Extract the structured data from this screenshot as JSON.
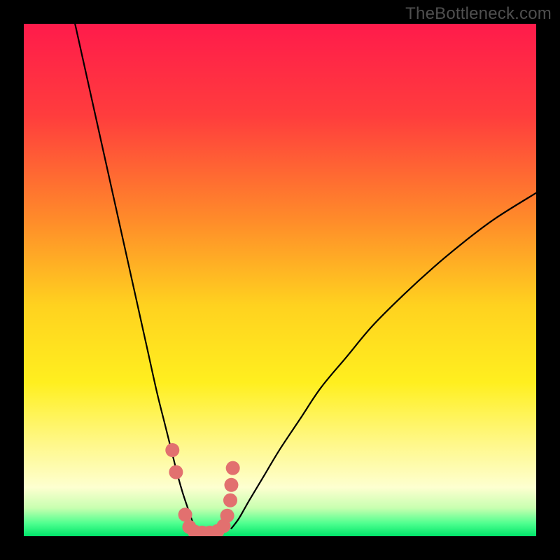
{
  "watermark": "TheBottleneck.com",
  "chart_data": {
    "type": "line",
    "title": "",
    "xlabel": "",
    "ylabel": "",
    "xlim": [
      0,
      100
    ],
    "ylim": [
      0,
      100
    ],
    "background_gradient": {
      "stops": [
        {
          "offset": 0.0,
          "color": "#ff1b4b"
        },
        {
          "offset": 0.18,
          "color": "#ff3d3d"
        },
        {
          "offset": 0.38,
          "color": "#ff8a2a"
        },
        {
          "offset": 0.55,
          "color": "#ffd21f"
        },
        {
          "offset": 0.7,
          "color": "#ffef1f"
        },
        {
          "offset": 0.82,
          "color": "#fff88a"
        },
        {
          "offset": 0.905,
          "color": "#fdffd0"
        },
        {
          "offset": 0.945,
          "color": "#c8ffb0"
        },
        {
          "offset": 0.975,
          "color": "#4fff8f"
        },
        {
          "offset": 1.0,
          "color": "#00e56a"
        }
      ]
    },
    "series": [
      {
        "name": "left-curve",
        "x": [
          10,
          12,
          14,
          16,
          18,
          20,
          22,
          24,
          26,
          27.5,
          29,
          30,
          31,
          32,
          32.8,
          33.5
        ],
        "y": [
          100,
          91,
          82,
          73,
          64,
          55,
          46,
          37,
          28,
          22,
          16,
          12,
          8.5,
          5.5,
          3.2,
          1.5
        ],
        "stroke": "#000000",
        "stroke_width": 2.2
      },
      {
        "name": "right-curve",
        "x": [
          40.5,
          42,
          44,
          47,
          50,
          54,
          58,
          63,
          68,
          74,
          80,
          86,
          92,
          100
        ],
        "y": [
          1.5,
          3.5,
          7,
          12,
          17,
          23,
          29,
          35,
          41,
          47,
          52.5,
          57.5,
          62,
          67
        ],
        "stroke": "#000000",
        "stroke_width": 2.2
      },
      {
        "name": "dot-cluster",
        "type": "scatter",
        "x": [
          29.0,
          29.7,
          31.5,
          32.3,
          33.3,
          34.8,
          36.3,
          37.8,
          39.0,
          39.7,
          40.3,
          40.5,
          40.8
        ],
        "y": [
          16.8,
          12.5,
          4.2,
          1.8,
          0.9,
          0.7,
          0.7,
          1.0,
          2.0,
          4.0,
          7.0,
          10.0,
          13.3
        ],
        "marker_color": "#e2706f",
        "marker_radius": 10
      }
    ]
  }
}
